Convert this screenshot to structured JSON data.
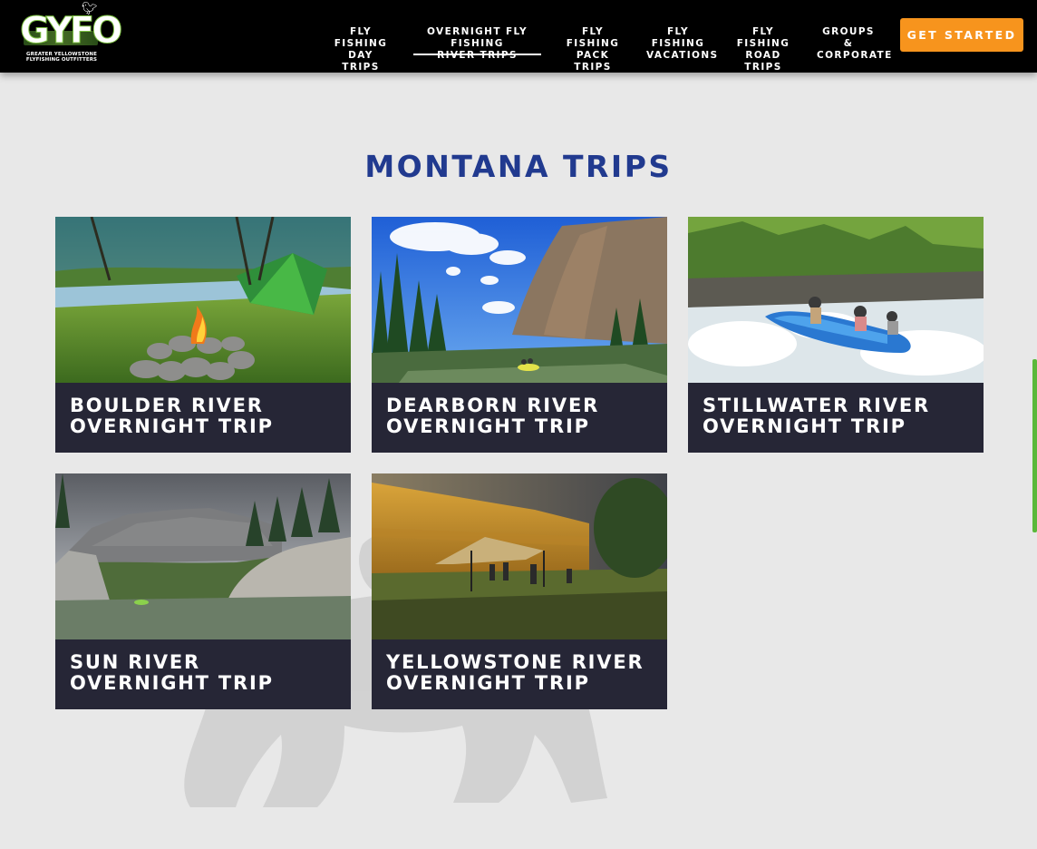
{
  "header": {
    "logo": {
      "wordmark": "GYFO",
      "subtitle_line1": "GREATER YELLOWSTONE",
      "subtitle_line2": "FLYFISHING OUTFITTERS"
    },
    "nav": [
      {
        "label": "FLY FISHING\nDAY TRIPS",
        "active": false
      },
      {
        "label": "OVERNIGHT FLY FISHING\nRIVER TRIPS",
        "active": true
      },
      {
        "label": "FLY FISHING\nPACK TRIPS",
        "active": false
      },
      {
        "label": "FLY FISHING\nVACATIONS",
        "active": false
      },
      {
        "label": "FLY FISHING\nROAD TRIPS",
        "active": false
      },
      {
        "label": "GROUPS &\nCORPORATE",
        "active": false
      }
    ],
    "cta_label": "GET STARTED"
  },
  "main": {
    "title": "MONTANA TRIPS",
    "trips": [
      {
        "title": "BOULDER RIVER OVERNIGHT TRIP"
      },
      {
        "title": "DEARBORN RIVER OVERNIGHT TRIP"
      },
      {
        "title": "STILLWATER RIVER OVERNIGHT TRIP"
      },
      {
        "title": "SUN RIVER OVERNIGHT TRIP"
      },
      {
        "title": "YELLOWSTONE RIVER OVERNIGHT TRIP"
      }
    ]
  },
  "colors": {
    "header_bg": "#000000",
    "page_bg": "#e8e8e8",
    "title": "#213a8f",
    "card_bg": "#262636",
    "cta": "#f7941d",
    "brand_green": "#7dc242"
  }
}
